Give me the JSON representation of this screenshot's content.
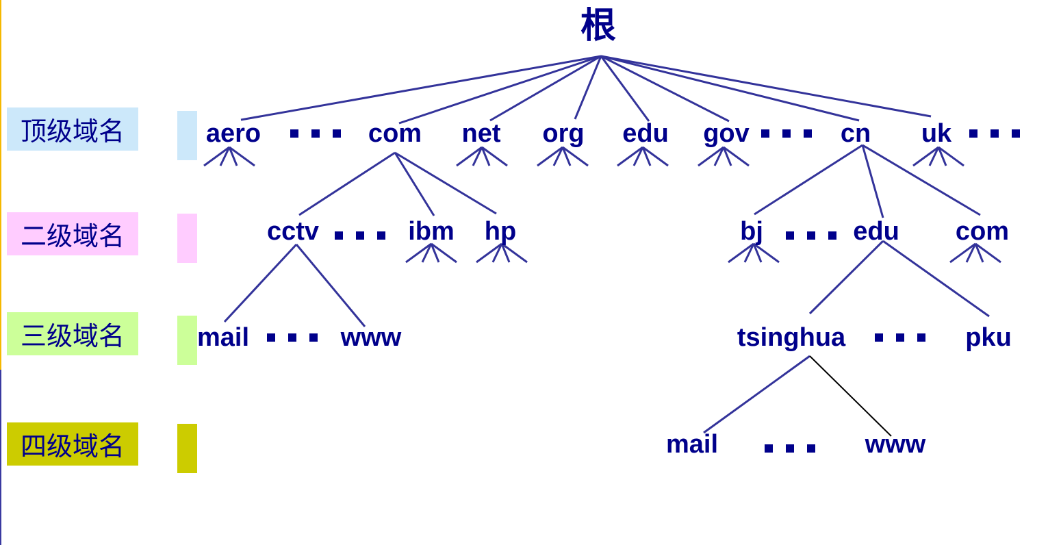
{
  "root": {
    "label": "根"
  },
  "levels": [
    {
      "label": "顶级域名",
      "color": "#cce8fa"
    },
    {
      "label": "二级域名",
      "color": "#ffccff"
    },
    {
      "label": "三级域名",
      "color": "#ccff99"
    },
    {
      "label": "四级域名",
      "color": "#cccc00"
    }
  ],
  "top_level": [
    "aero",
    "com",
    "net",
    "org",
    "edu",
    "gov",
    "cn",
    "uk"
  ],
  "second_level": {
    "com": [
      "cctv",
      "ibm",
      "hp"
    ],
    "cn": [
      "bj",
      "edu",
      "com"
    ]
  },
  "third_level": {
    "cctv": [
      "mail",
      "www"
    ],
    "edu": [
      "tsinghua",
      "pku"
    ]
  },
  "fourth_level": {
    "tsinghua": [
      "mail",
      "www"
    ]
  },
  "colors": {
    "text": "#00008b",
    "edge": "#33339a"
  }
}
